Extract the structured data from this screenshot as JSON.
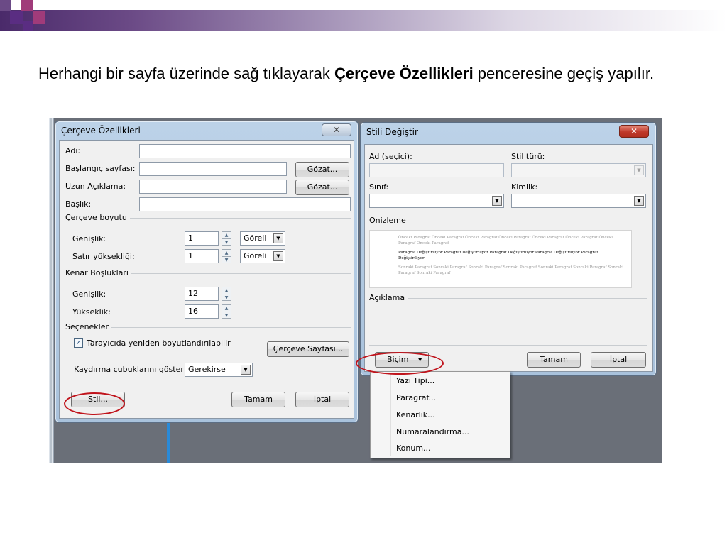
{
  "slide": {
    "text_before": "Herhangi bir sayfa üzerinde sağ tıklayarak ",
    "text_bold": "Çerçeve Özellikleri",
    "text_after": " penceresine geçiş yapılır."
  },
  "frame_dialog": {
    "title": "Çerçeve Özellikleri",
    "close_label": "✕",
    "adi_label": "Adı:",
    "adi_value": "",
    "start_page_label": "Başlangıç sayfası:",
    "start_page_value": "",
    "browse_label": "Gözat...",
    "long_desc_label": "Uzun Açıklama:",
    "long_desc_value": "",
    "browse2_label": "Gözat...",
    "title_label": "Başlık:",
    "title_value": "",
    "frame_size_group": "Çerçeve boyutu",
    "width_label": "Genişlik:",
    "width_value": "1",
    "width_unit": "Göreli",
    "row_height_label": "Satır yüksekliği:",
    "row_height_value": "1",
    "row_height_unit": "Göreli",
    "margins_group": "Kenar Boşlukları",
    "margin_width_label": "Genişlik:",
    "margin_width_value": "12",
    "margin_height_label": "Yükseklik:",
    "margin_height_value": "16",
    "options_group": "Seçenekler",
    "resizable_label": "Tarayıcıda yeniden boyutlandırılabilir",
    "resizable_checked": true,
    "frame_page_button": "Çerçeve  Sayfası...",
    "scrollbars_label": "Kaydırma çubuklarını göster:",
    "scrollbars_value": "Gerekirse",
    "style_button": "Stil...",
    "ok_button": "Tamam",
    "cancel_button": "İptal"
  },
  "style_dialog": {
    "title": "Stili Değiştir",
    "close_label": "✕",
    "name_label": "Ad (seçici):",
    "name_value": "",
    "style_type_label": "Stil türü:",
    "style_type_value": "",
    "class_label": "Sınıf:",
    "class_value": "",
    "id_label": "Kimlik:",
    "id_value": "",
    "preview_group": "Önizleme",
    "preview_prev": "Önceki Paragraf Önceki Paragraf Önceki Paragraf Önceki Paragraf Önceki Paragraf Önceki Paragraf Önceki Paragraf Önceki Paragraf",
    "preview_current": "Paragraf Değiştiriliyor Paragraf Değiştiriliyor Paragraf Değiştiriliyor Paragraf Değiştiriliyor Paragraf Değiştiriliyor",
    "preview_next": "Sonraki Paragraf Sonraki Paragraf Sonraki Paragraf Sonraki Paragraf Sonraki Paragraf Sonraki Paragraf Sonraki Paragraf Sonraki Paragraf",
    "description_group": "Açıklama",
    "format_button": "Biçim",
    "format_arrow": "▾",
    "ok_button": "Tamam",
    "cancel_button": "İptal"
  },
  "format_menu": {
    "items": [
      "Yazı Tipi...",
      "Paragraf...",
      "Kenarlık...",
      "Numaralandırma...",
      "Konum..."
    ]
  },
  "colors": {
    "highlight_ellipse": "#c0141c",
    "title_bar": "#bcd2e8",
    "close_red": "#c0392b"
  }
}
